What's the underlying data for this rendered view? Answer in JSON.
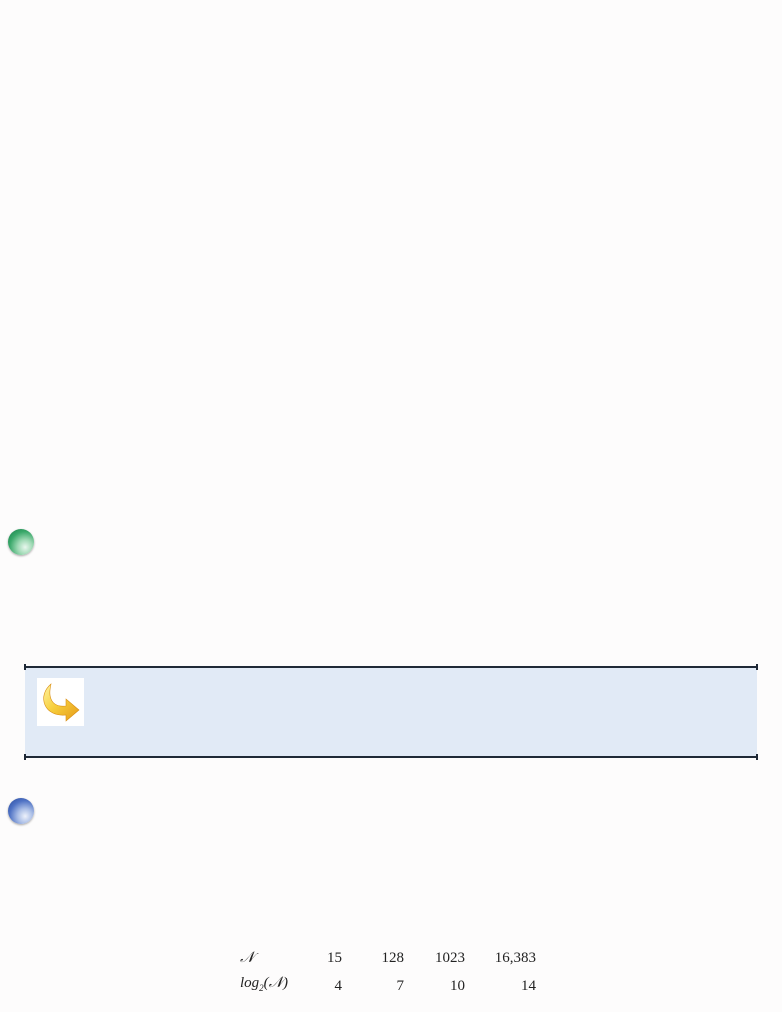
{
  "callout": {
    "icon": "curved-arrow-icon",
    "background_color": "#e1eaf6",
    "border_color": "#1f2937"
  },
  "bullets": [
    {
      "icon": "green-circle-bullet-icon",
      "color": "#3aa86a"
    },
    {
      "icon": "blue-circle-bullet-icon",
      "color": "#4f72c4"
    }
  ],
  "table": {
    "row1_label": "𝒩",
    "row2_label_prefix": "log",
    "row2_label_sub": "2",
    "row2_label_arg": "(𝒩)",
    "row1_values": [
      "15",
      "128",
      "1023",
      "16,383"
    ],
    "row2_values": [
      "4",
      "7",
      "10",
      "14"
    ]
  }
}
